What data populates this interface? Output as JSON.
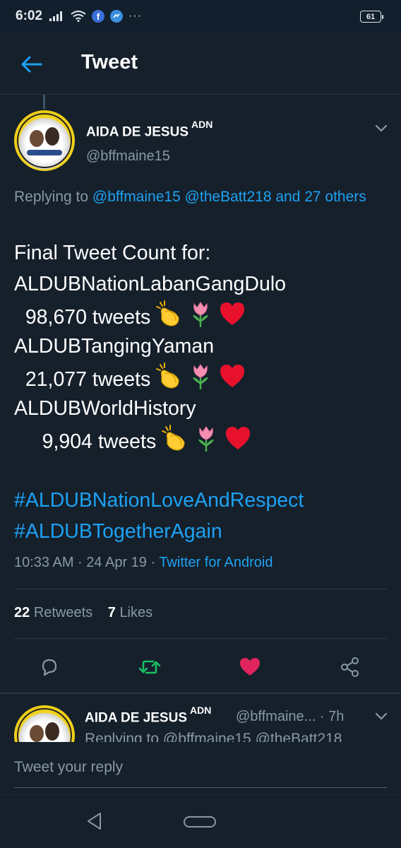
{
  "status_bar": {
    "time": "6:02",
    "battery": "61",
    "more": "···"
  },
  "app_bar": {
    "title": "Tweet"
  },
  "tweet": {
    "author_name": "AIDA DE JESUS",
    "author_suffix": "ADN",
    "author_handle": "@bffmaine15",
    "replying_prefix": "Replying to ",
    "replying_user1": "@bffmaine15",
    "replying_user2": "@theBatt218",
    "replying_rest": " and 27 others",
    "lines": [
      "Final Tweet Count for:",
      "ALDUBNationLabanGangDulo",
      "  98,670 tweets",
      "ALDUBTangingYaman",
      "  21,077 tweets",
      "ALDUBWorldHistory",
      "     9,904 tweets"
    ],
    "hashtags": [
      "#ALDUBNationLoveAndRespect",
      "#ALDUBTogetherAgain"
    ],
    "time": "10:33 AM · 24 Apr 19 · ",
    "source": "Twitter for Android",
    "retweets_count": "22",
    "retweets_label": "Retweets",
    "likes_count": "7",
    "likes_label": "Likes"
  },
  "reply": {
    "author_name": "AIDA DE JESUS",
    "author_suffix": "ADN",
    "handle_time": "@bffmaine... · 7h",
    "preview": "Replying to @bffmaine15 @theBatt218"
  },
  "compose": {
    "placeholder": "Tweet your reply"
  },
  "colors": {
    "background": "#15202b",
    "accent": "#1da1f2",
    "retweet": "#17bf63",
    "like": "#e0245e",
    "muted": "#8899a6"
  },
  "icons": {
    "back": "arrow-left-icon",
    "chevron": "chevron-down-icon",
    "reply": "comment-icon",
    "retweet": "retweet-icon",
    "like": "heart-icon",
    "share": "share-icon",
    "emoji": [
      "clapping-hands-icon",
      "tulip-icon",
      "red-heart-icon"
    ]
  }
}
